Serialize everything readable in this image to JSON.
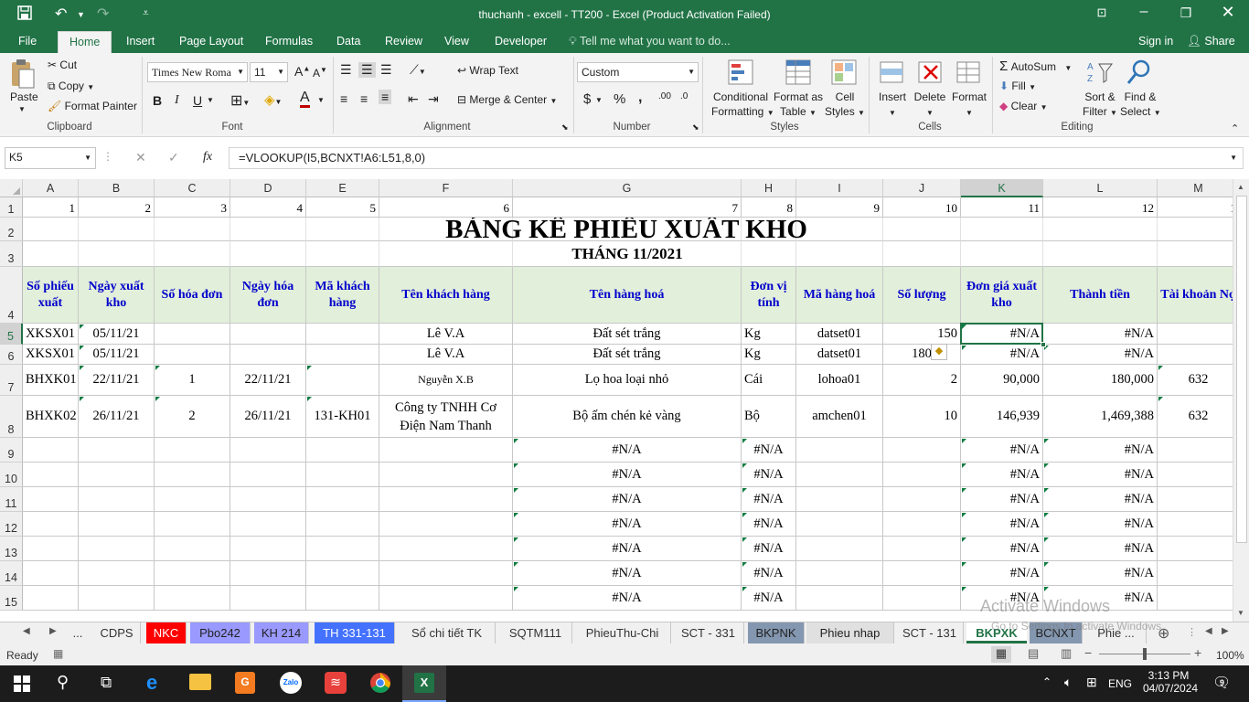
{
  "window": {
    "title": "thuchanh - excell - TT200 - Excel (Product Activation Failed)"
  },
  "ribbon_tabs": [
    "File",
    "Home",
    "Insert",
    "Page Layout",
    "Formulas",
    "Data",
    "Review",
    "View",
    "Developer"
  ],
  "tell_me": "Tell me what you want to do...",
  "account": {
    "sign_in": "Sign in",
    "share": "Share"
  },
  "clipboard": {
    "paste": "Paste",
    "cut": "Cut",
    "copy": "Copy",
    "format_painter": "Format Painter",
    "label": "Clipboard"
  },
  "font": {
    "name": "Times New Roma",
    "size": "11",
    "bold": "B",
    "italic": "I",
    "underline": "U",
    "label": "Font"
  },
  "alignment": {
    "wrap_text": "Wrap Text",
    "merge_center": "Merge & Center",
    "label": "Alignment"
  },
  "number": {
    "format": "Custom",
    "currency": "$",
    "percent": "%",
    "comma": ",",
    "label": "Number"
  },
  "styles": {
    "conditional": [
      "Conditional",
      "Formatting"
    ],
    "format_table": [
      "Format as",
      "Table"
    ],
    "cell_styles": [
      "Cell",
      "Styles"
    ],
    "label": "Styles"
  },
  "cells": {
    "insert": "Insert",
    "delete": "Delete",
    "format": "Format",
    "label": "Cells"
  },
  "editing": {
    "autosum": "AutoSum",
    "fill": "Fill",
    "clear": "Clear",
    "sort": [
      "Sort &",
      "Filter"
    ],
    "find": [
      "Find &",
      "Select"
    ],
    "label": "Editing"
  },
  "formula_bar": {
    "name_box": "K5",
    "fx": "fx",
    "formula": "=VLOOKUP(I5,BCNXT!A6:L51,8,0)"
  },
  "columns": [
    "A",
    "B",
    "C",
    "D",
    "E",
    "F",
    "G",
    "H",
    "I",
    "J",
    "K",
    "L",
    "M"
  ],
  "row_numbers": [
    "1",
    "2",
    "3",
    "4",
    "5",
    "6",
    "7",
    "8",
    "9",
    "10",
    "11",
    "12",
    "13",
    "14",
    "15"
  ],
  "row1_numbers": [
    "1",
    "2",
    "3",
    "4",
    "5",
    "6",
    "7",
    "8",
    "9",
    "10",
    "11",
    "12",
    "1"
  ],
  "sheet_title": "BẢNG KÊ PHIẾU XUẤT KHO",
  "sheet_subtitle": "THÁNG 11/2021",
  "headers": [
    "Số phiếu xuất",
    "Ngày xuất kho",
    "Số hóa đơn",
    "Ngày hóa đơn",
    "Mã khách hàng",
    "Tên khách hàng",
    "Tên hàng hoá",
    "Đơn vị tính",
    "Mã hàng hoá",
    "Số lượng",
    "Đơn giá xuất kho",
    "Thành tiền",
    "Tài khoản Nợ"
  ],
  "data_rows": [
    [
      "XKSX01",
      "05/11/21",
      "",
      "",
      "",
      "Lê V.A",
      "Đất sét trắng",
      "Kg",
      "datset01",
      "150",
      "#N/A",
      "#N/A",
      ""
    ],
    [
      "XKSX01",
      "05/11/21",
      "",
      "",
      "",
      "Lê V.A",
      "Đất sét trắng",
      "Kg",
      "datset01",
      "180",
      "#N/A",
      "#N/A",
      ""
    ],
    [
      "BHXK01",
      "22/11/21",
      "1",
      "22/11/21",
      "",
      "Nguyễn X.B",
      "Lọ hoa loại nhỏ",
      "Cái",
      "lohoa01",
      "2",
      "90,000",
      "180,000",
      "632"
    ],
    [
      "BHXK02",
      "26/11/21",
      "2",
      "26/11/21",
      "131-KH01",
      "Công ty TNHH Cơ Điện Nam Thanh",
      "Bộ ấm chén kẻ vàng",
      "Bộ",
      "amchen01",
      "10",
      "146,939",
      "1,469,388",
      "632"
    ]
  ],
  "na_value": "#N/A",
  "sheet_tabs": [
    "...",
    "CDPS",
    "NKC",
    "Pbo242",
    "KH 214",
    "TH 331-131",
    "Sổ chi tiết TK",
    "SQTM111",
    "PhieuThu-Chi",
    "SCT - 331",
    "BKPNK",
    "Phieu nhap",
    "SCT - 131",
    "BKPXK",
    "BCNXT",
    "Phie ..."
  ],
  "status": {
    "ready": "Ready",
    "zoom": "100%"
  },
  "watermark": {
    "line1": "Activate Windows",
    "line2": "Go to Settings to activate Windows."
  },
  "taskbar": {
    "time": "3:13 PM",
    "date": "04/07/2024",
    "lang": "ENG",
    "notifications": "9"
  },
  "colors": {
    "excel_green": "#217346",
    "header_fill": "#e2efda",
    "header_text": "#0000cc",
    "nkc_tab": "#ff0000",
    "blue_tab": "#4472ff",
    "lav_tab": "#9999ff",
    "gray_tab": "#8497b0"
  }
}
